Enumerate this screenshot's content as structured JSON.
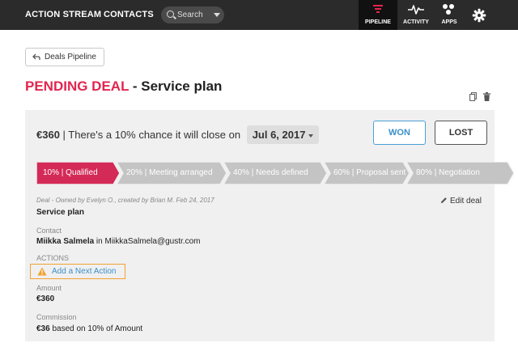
{
  "nav": {
    "links": [
      "Action Stream",
      "Contacts"
    ],
    "search_placeholder": "Search",
    "right": {
      "pipeline": "Pipeline",
      "activity": "Activity",
      "apps": "Apps"
    },
    "colors": {
      "bg": "#2b2b2b",
      "active_bg": "#111111",
      "pipeline_icon": "#e2254f"
    }
  },
  "back_button": {
    "label": "Deals Pipeline"
  },
  "deal_title": {
    "status": "PENDING DEAL",
    "separator": " - ",
    "name": "Service plan"
  },
  "summary": {
    "amount": "€360",
    "text": "| There's a 10% chance it will close on",
    "close_date": "Jul 6, 2017"
  },
  "actions": {
    "won": "WON",
    "lost": "LOST"
  },
  "stages": [
    {
      "label": "10% | Qualified",
      "active": true
    },
    {
      "label": "20% | Meeting arranged",
      "active": false
    },
    {
      "label": "40% | Needs defined",
      "active": false
    },
    {
      "label": "60% | Proposal sent",
      "active": false
    },
    {
      "label": "80% | Negotiation",
      "active": false
    }
  ],
  "stage_colors": {
    "active": "#d42a57",
    "inactive": "#c4c4c4"
  },
  "details": {
    "meta": "Deal - Owned by Evelyn O., created by Brian M. Feb 24, 2017",
    "deal_name": "Service plan",
    "edit_label": "Edit deal",
    "contact_label": "Contact",
    "contact_name": "Miikka Salmela",
    "contact_in": " in ",
    "contact_email": "MiikkaSalmela@gustr.com",
    "actions_label": "ACTIONS",
    "next_action": "Add a Next Action",
    "amount_label": "Amount",
    "amount_value": "€360",
    "commission_label": "Commission",
    "commission_value": "€36",
    "commission_note": " based on 10% of Amount"
  },
  "icons": {
    "search": "search-icon",
    "pipeline": "pipeline-icon",
    "activity": "activity-pulse-icon",
    "apps": "apps-icon",
    "settings": "gear-icon",
    "back": "back-arrow-icon",
    "copy": "copy-icon",
    "delete": "trash-icon",
    "edit": "pencil-icon",
    "warning": "warning-icon"
  }
}
